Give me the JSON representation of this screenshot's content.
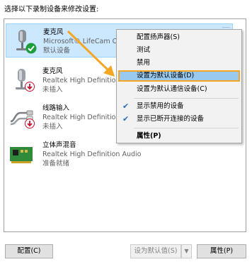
{
  "instruction": "选择以下录制设备来修改设置:",
  "devices": [
    {
      "name": "麦克风",
      "driver": "Microsoft® LifeCam C",
      "status": "默认设备",
      "icon": "microphone-icon",
      "badge": "default-check-icon"
    },
    {
      "name": "麦克风",
      "driver": "Realtek High Definitio",
      "status": "未插入",
      "icon": "microphone-icon",
      "badge": "unplugged-arrow-icon"
    },
    {
      "name": "线路输入",
      "driver": "Realtek High Definitio",
      "status": "未插入",
      "icon": "line-in-cable-icon",
      "badge": "unplugged-arrow-icon"
    },
    {
      "name": "立体声混音",
      "driver": "Realtek High Definition Audio",
      "status": "准备就绪",
      "icon": "sound-card-icon"
    }
  ],
  "context_menu": {
    "items": [
      {
        "label": "配置扬声器(S)"
      },
      {
        "label": "测试"
      },
      {
        "label": "禁用"
      },
      {
        "label": "设置为默认设备(D)",
        "highlighted": true
      },
      {
        "label": "设置为默认通信设备(C)"
      },
      {
        "label": "显示禁用的设备",
        "checked": true
      },
      {
        "label": "显示已断开连接的设备",
        "checked": true
      },
      {
        "label": "属性(P)",
        "bold": true
      }
    ]
  },
  "buttons": {
    "configure": "配置(C)",
    "set_default": "设为默认值(S)",
    "properties": "属性(P)"
  },
  "colors": {
    "selection": "#cce8ff",
    "menu_highlight": "#99c9ef",
    "annotation_orange": "#f5a623",
    "default_badge": "#1e9e3a",
    "unplugged_badge": "#c8102e"
  }
}
